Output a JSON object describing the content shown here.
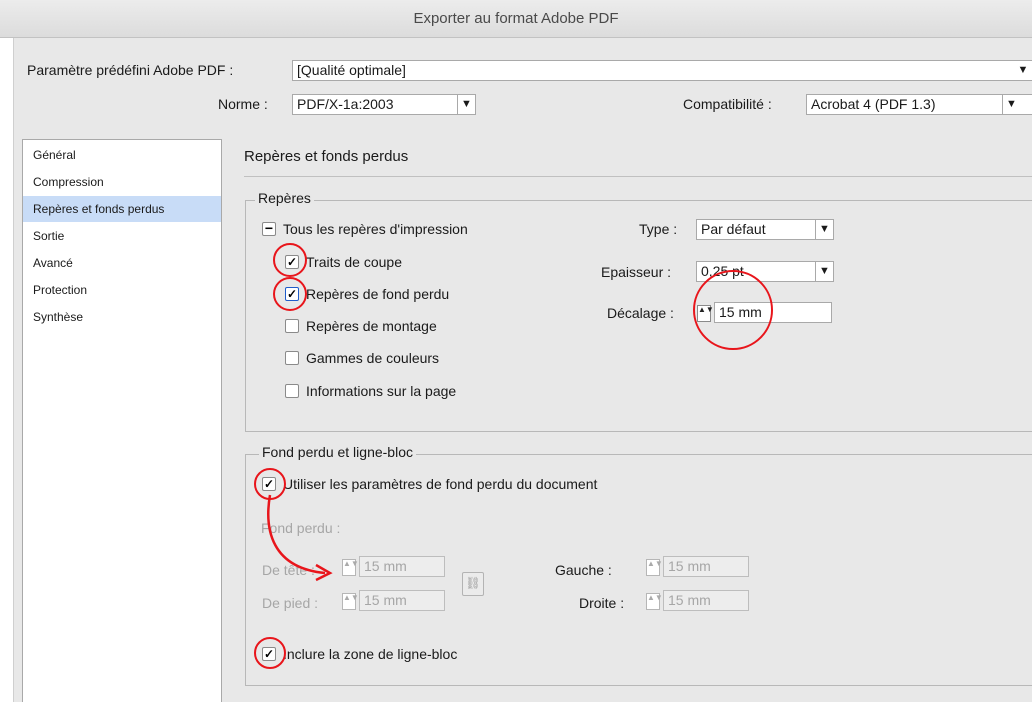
{
  "window": {
    "title": "Exporter au format Adobe PDF"
  },
  "preset": {
    "label": "Paramètre prédéfini Adobe PDF :",
    "value": "[Qualité optimale]"
  },
  "norme": {
    "label": "Norme :",
    "value": "PDF/X-1a:2003"
  },
  "compat": {
    "label": "Compatibilité :",
    "value": "Acrobat 4 (PDF 1.3)"
  },
  "sidebar": {
    "items": [
      {
        "label": "Général",
        "selected": false
      },
      {
        "label": "Compression",
        "selected": false
      },
      {
        "label": "Repères et fonds perdus",
        "selected": true
      },
      {
        "label": "Sortie",
        "selected": false
      },
      {
        "label": "Avancé",
        "selected": false
      },
      {
        "label": "Protection",
        "selected": false
      },
      {
        "label": "Synthèse",
        "selected": false
      }
    ]
  },
  "section": {
    "title": "Repères et fonds perdus"
  },
  "marks": {
    "legend": "Repères",
    "all_label": "Tous les repères d'impression",
    "checks": [
      {
        "label": "Traits de coupe",
        "checked": true
      },
      {
        "label": "Repères de fond perdu",
        "checked": true
      },
      {
        "label": "Repères de montage",
        "checked": false
      },
      {
        "label": "Gammes de couleurs",
        "checked": false
      },
      {
        "label": "Informations sur la page",
        "checked": false
      }
    ],
    "type_label": "Type :",
    "type_value": "Par défaut",
    "weight_label": "Epaisseur :",
    "weight_value": "0,25 pt",
    "offset_label": "Décalage :",
    "offset_value": "15 mm"
  },
  "bleed": {
    "legend": "Fond perdu et ligne-bloc",
    "use_doc_label": "Utiliser les paramètres de fond perdu du document",
    "sub_label": "Fond perdu :",
    "top_label": "De tête :",
    "top_value": "15 mm",
    "bottom_label": "De pied :",
    "bottom_value": "15 mm",
    "left_label": "Gauche :",
    "left_value": "15 mm",
    "right_label": "Droite :",
    "right_value": "15 mm",
    "slug_label": "Inclure la zone de ligne-bloc"
  },
  "annotation": {
    "color": "#e8151b"
  },
  "glyphs": {
    "check": "✓",
    "dropdown": "▼",
    "minus": "−",
    "stepper": "▲▼",
    "link": "⛓"
  }
}
